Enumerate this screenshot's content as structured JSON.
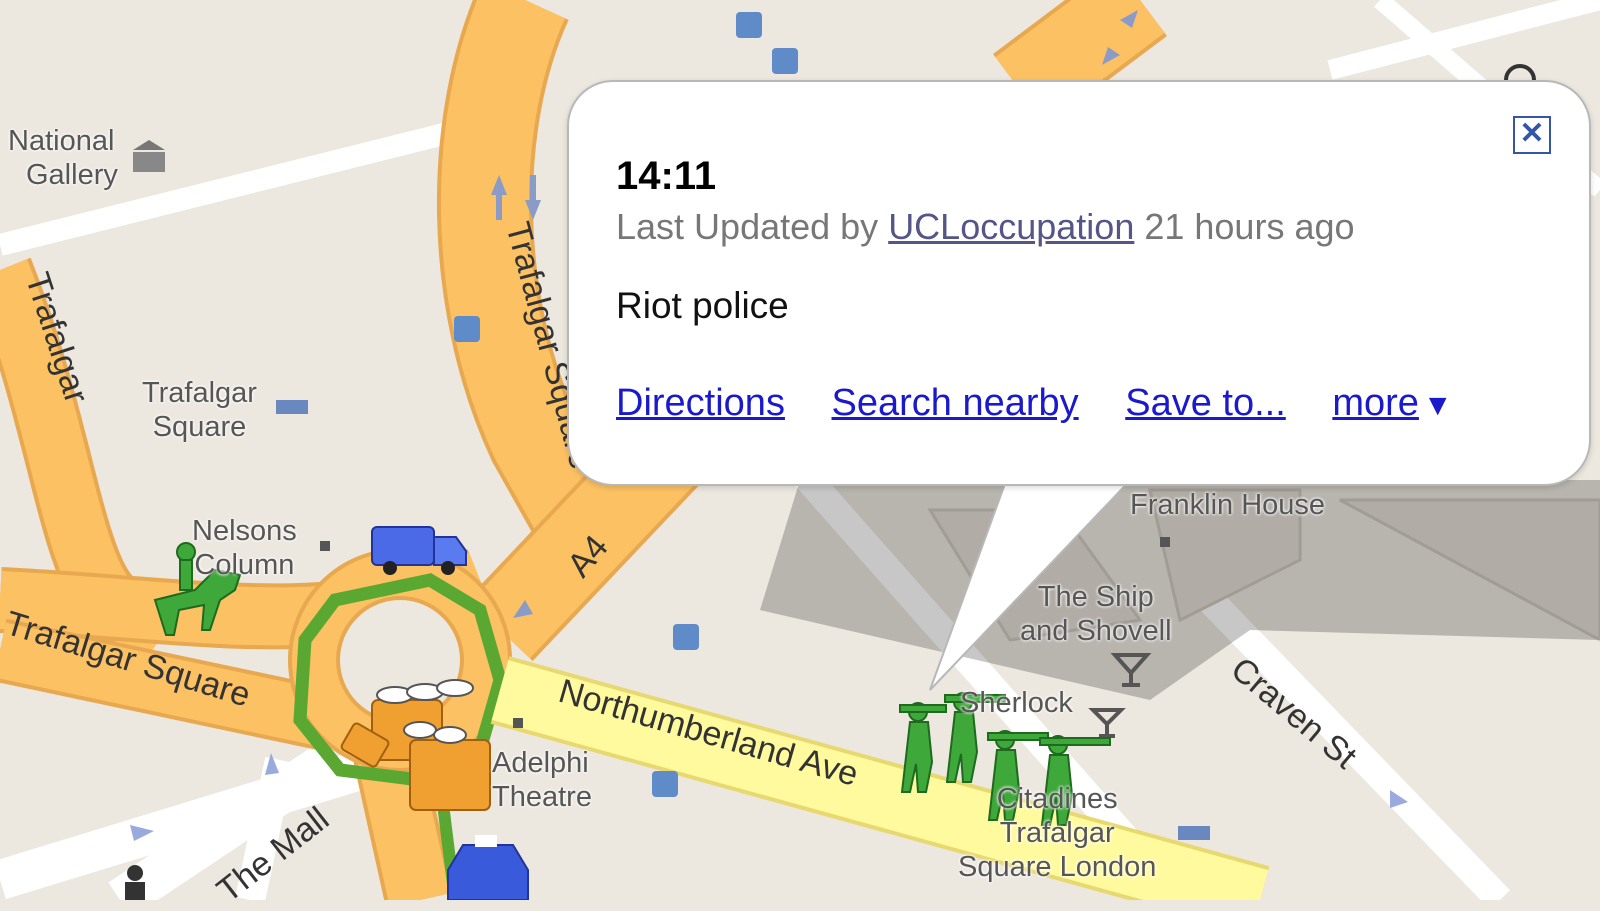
{
  "info_window": {
    "time": "14:11",
    "meta_prefix": "Last Updated by ",
    "meta_user": "UCLoccupation",
    "meta_suffix": " 21 hours ago",
    "description": "Riot police",
    "links": {
      "directions": "Directions",
      "search_nearby": "Search nearby",
      "save_to": "Save to...",
      "more": "more"
    },
    "close_icon": "close-icon"
  },
  "map": {
    "places": {
      "national_gallery_1": "National",
      "national_gallery_2": "Gallery",
      "trafalgar_hotel_1": "Trafalgar",
      "trafalgar_hotel_2": "Square",
      "nelsons_column_1": "Nelsons",
      "nelsons_column_2": "Column",
      "franklin_house": "Franklin House",
      "ship_shovell_1": "The Ship",
      "ship_shovell_2": "and Shovell",
      "sherlock": "Sherlock",
      "adelphi_1": "Adelphi",
      "adelphi_2": "Theatre",
      "thistle_1": "Citadines",
      "thistle_2": "Trafalgar",
      "thistle_3": "Square London"
    },
    "roads": {
      "trafalgar_sq_vertical": "Trafalgar Square",
      "trafalgar_sq_left": "Trafalgar Square",
      "trafalgar_left_edge": "Trafalgar",
      "a4": "A4",
      "northumberland": "Northumberland Ave",
      "craven": "Craven St",
      "the_mall": "The Mall"
    },
    "colors": {
      "land": "#ece7df",
      "major_road": "#fcc162",
      "yellow_road": "#fffa9e",
      "minor_road": "#ffffff",
      "route": "#5aa832",
      "marker_green": "#3fa83a",
      "marker_orange": "#f0a030",
      "marker_blue": "#3a5adc"
    }
  }
}
